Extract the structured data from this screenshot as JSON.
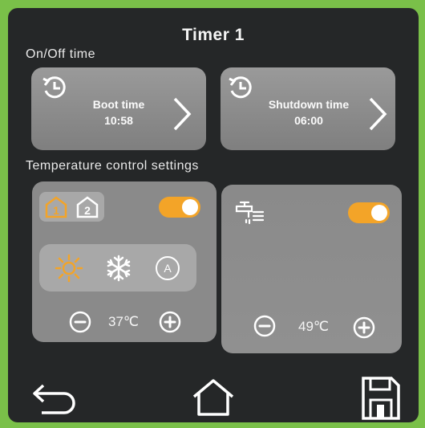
{
  "header": {
    "title": "Timer 1"
  },
  "on_off": {
    "label": "On/Off time",
    "boot": {
      "label": "Boot time",
      "time": "10:58"
    },
    "shutdown": {
      "label": "Shutdown time",
      "time": "06:00"
    }
  },
  "temperature": {
    "label": "Temperature control settings",
    "zone_left": {
      "zones": [
        "1",
        "2"
      ],
      "selected_zone": "1",
      "enabled": true,
      "modes": [
        "sun-icon",
        "snowflake-icon",
        "auto-icon"
      ],
      "selected_mode": "sun-icon",
      "value": "37℃"
    },
    "zone_right": {
      "enabled": true,
      "value": "49℃"
    }
  },
  "footer": {
    "icons": [
      "back-arrow-icon",
      "home-icon",
      "save-icon"
    ]
  },
  "colors": {
    "accent": "#f3a428",
    "card": "#8e8e8e",
    "background": "#252728",
    "frame": "#7ac049"
  }
}
